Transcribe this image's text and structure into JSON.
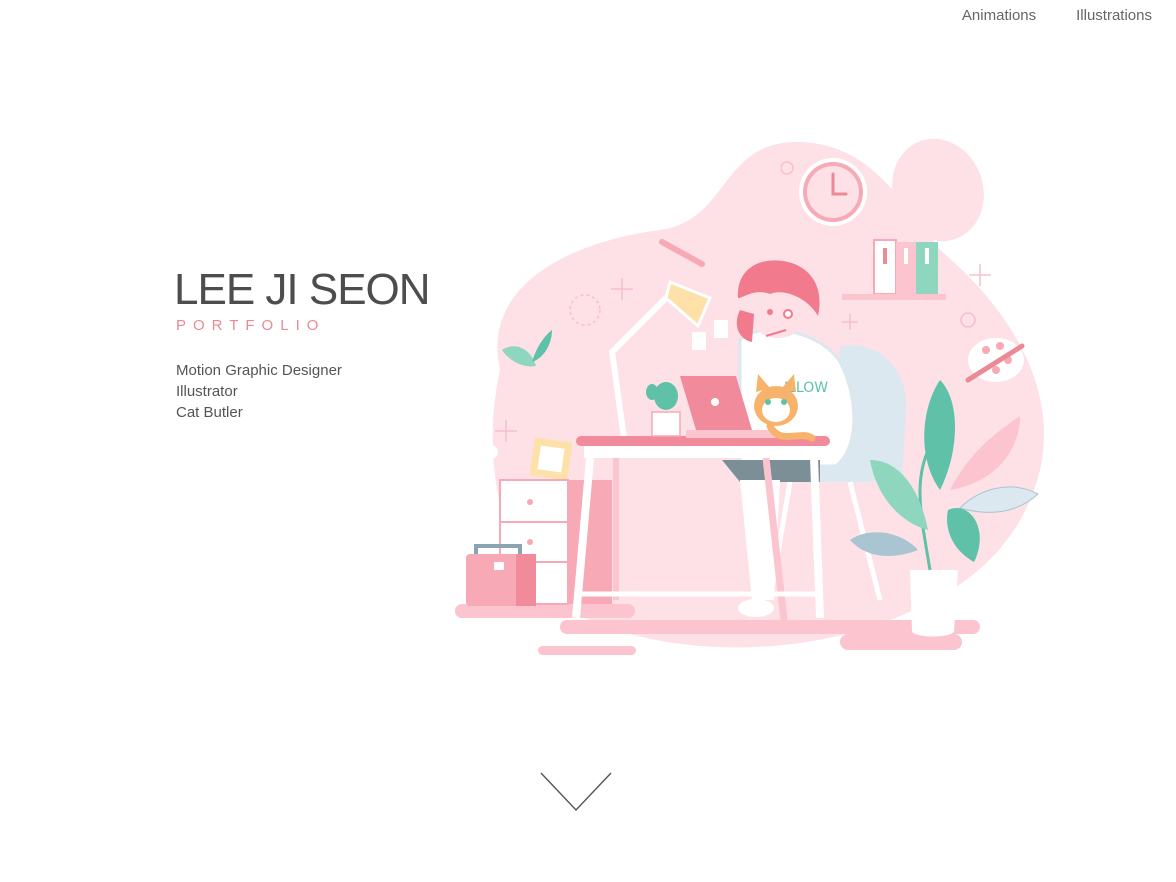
{
  "nav": {
    "items": [
      {
        "label": "Animations"
      },
      {
        "label": "Illustrations"
      }
    ]
  },
  "hero": {
    "name": "LEE JI SEON",
    "subtitle": "PORTFOLIO",
    "roles": [
      "Motion Graphic Designer",
      "Illustrator",
      "Cat Butler"
    ],
    "illustration_shirt_text": "ILLOW"
  },
  "colors": {
    "accent_pink": "#e98a95",
    "blob_pink": "#fde1e7",
    "mint": "#5fc1a8"
  },
  "icons": {
    "scroll": "chevron-down-icon"
  }
}
